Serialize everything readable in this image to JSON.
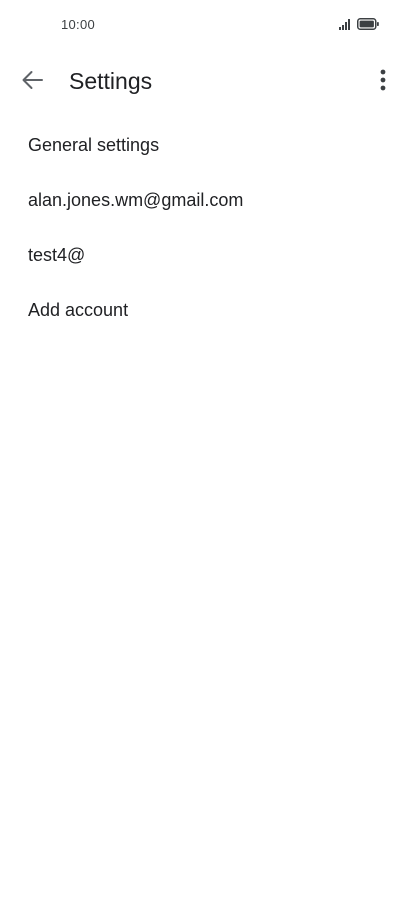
{
  "status_bar": {
    "time": "10:00",
    "signal_icon": "signal-icon",
    "battery_icon": "battery-icon"
  },
  "app_bar": {
    "back_icon": "arrow-back-icon",
    "title": "Settings",
    "more_icon": "more-vert-icon"
  },
  "settings": {
    "items": [
      {
        "label": "General settings"
      },
      {
        "label": "alan.jones.wm@gmail.com"
      },
      {
        "label": "test4@"
      },
      {
        "label": "Add account"
      }
    ]
  },
  "colors": {
    "background": "#ffffff",
    "text_primary": "#202124",
    "icon": "#5f6368"
  }
}
